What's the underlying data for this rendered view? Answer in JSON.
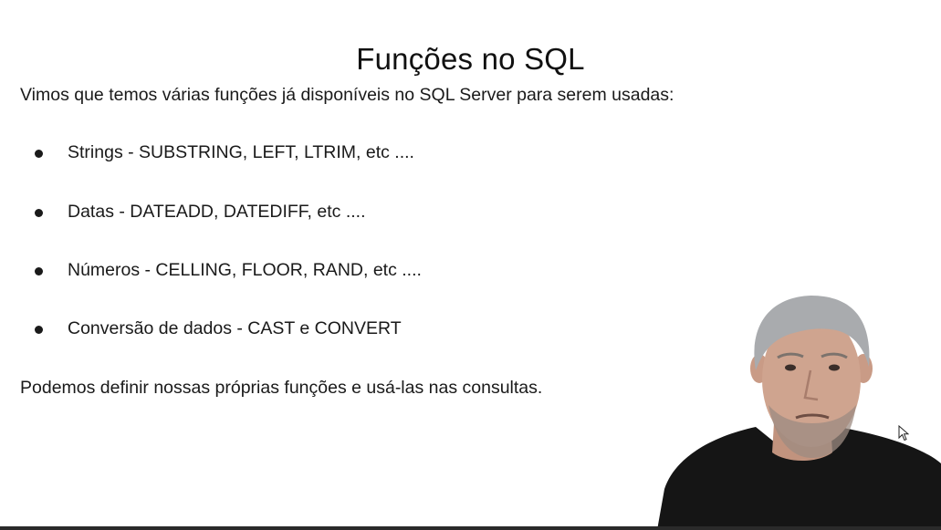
{
  "slide": {
    "title": "Funções no SQL",
    "intro": "Vimos que temos várias funções já disponíveis no SQL Server para serem usadas:",
    "bullets": [
      {
        "label": "Strings - SUBSTRING, LEFT, LTRIM, etc ...."
      },
      {
        "label": "Datas - DATEADD, DATEDIFF, etc ...."
      },
      {
        "label": "Números - CELLING, FLOOR, RAND, etc ...."
      },
      {
        "label": "Conversão de dados - CAST e CONVERT"
      }
    ],
    "closing": "Podemos definir nossas próprias funções e usá-las nas consultas."
  },
  "colors": {
    "background": "#ffffff",
    "text": "#1a1a1a",
    "presenter_shirt": "#151515",
    "presenter_hair": "#a9abae",
    "presenter_skin": "#cfa48f"
  },
  "icons": {
    "bullet": "bullet-dot-icon",
    "cursor": "mouse-pointer-icon"
  }
}
